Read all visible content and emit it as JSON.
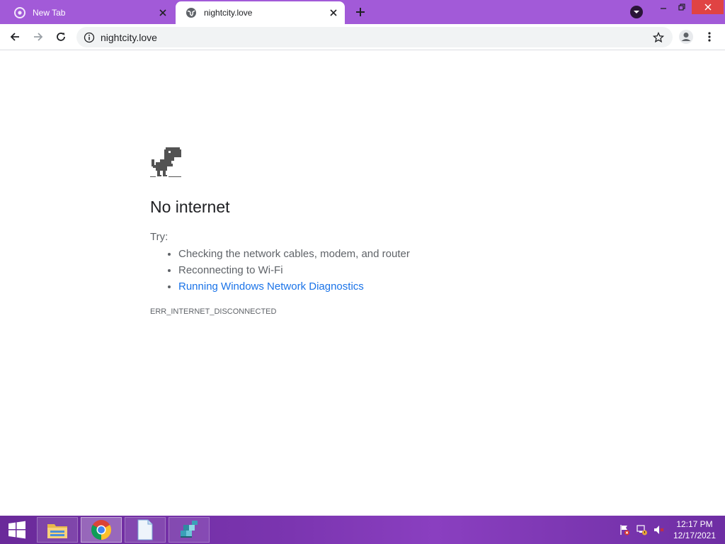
{
  "browser": {
    "tabs": [
      {
        "title": "New Tab",
        "active": false
      },
      {
        "title": "nightcity.love",
        "active": true
      }
    ],
    "address_bar": {
      "url": "nightcity.love"
    }
  },
  "page": {
    "headline": "No internet",
    "try_label": "Try:",
    "suggestions": [
      "Checking the network cables, modem, and router",
      "Reconnecting to Wi-Fi",
      "Running Windows Network Diagnostics"
    ],
    "error_code": "ERR_INTERNET_DISCONNECTED"
  },
  "taskbar": {
    "apps": [
      "file-explorer",
      "chrome",
      "notepad",
      "recycle-app"
    ],
    "clock": {
      "time": "12:17 PM",
      "date": "12/17/2021"
    }
  },
  "colors": {
    "titlebar": "#a25ad8",
    "taskbar": "#7b35b0",
    "link": "#1a73e8",
    "close_button": "#e04343"
  }
}
